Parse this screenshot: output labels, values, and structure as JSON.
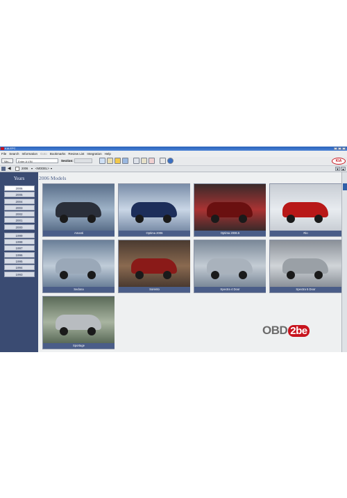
{
  "window": {
    "title": "KIA EPC"
  },
  "menu": [
    "File",
    "Search",
    "Information",
    "Goto",
    "Bookmarks",
    "Review List",
    "Integration",
    "Help"
  ],
  "toolbar": {
    "vin_button": "Vin...",
    "vin_placeholder": "Enter A VIN",
    "section_label": "Section:",
    "brand_logo": "KIA"
  },
  "nav": {
    "year_value": "2006",
    "model_value": "<MODEL>"
  },
  "sidebar": {
    "header": "Years",
    "years_group1": [
      "2006",
      "2005",
      "2004",
      "2003",
      "2002",
      "2001",
      "2000"
    ],
    "years_group2": [
      "1999",
      "1998",
      "1997",
      "1996",
      "1995",
      "1994",
      "1993"
    ],
    "selected": "2006"
  },
  "content": {
    "heading": "2006 Models",
    "models": [
      "Amanti",
      "Optima 2006",
      "Optima 2006.5",
      "Rio",
      "Sedona",
      "Sorento",
      "Spectra 4 Door",
      "Spectra 5 Door",
      "Sportage"
    ]
  },
  "watermark": {
    "prefix": "OBD",
    "suffix": "2be"
  },
  "colors": {
    "accent": "#4a5d88",
    "sidebar": "#3a4b72",
    "brand": "#c8141e"
  }
}
